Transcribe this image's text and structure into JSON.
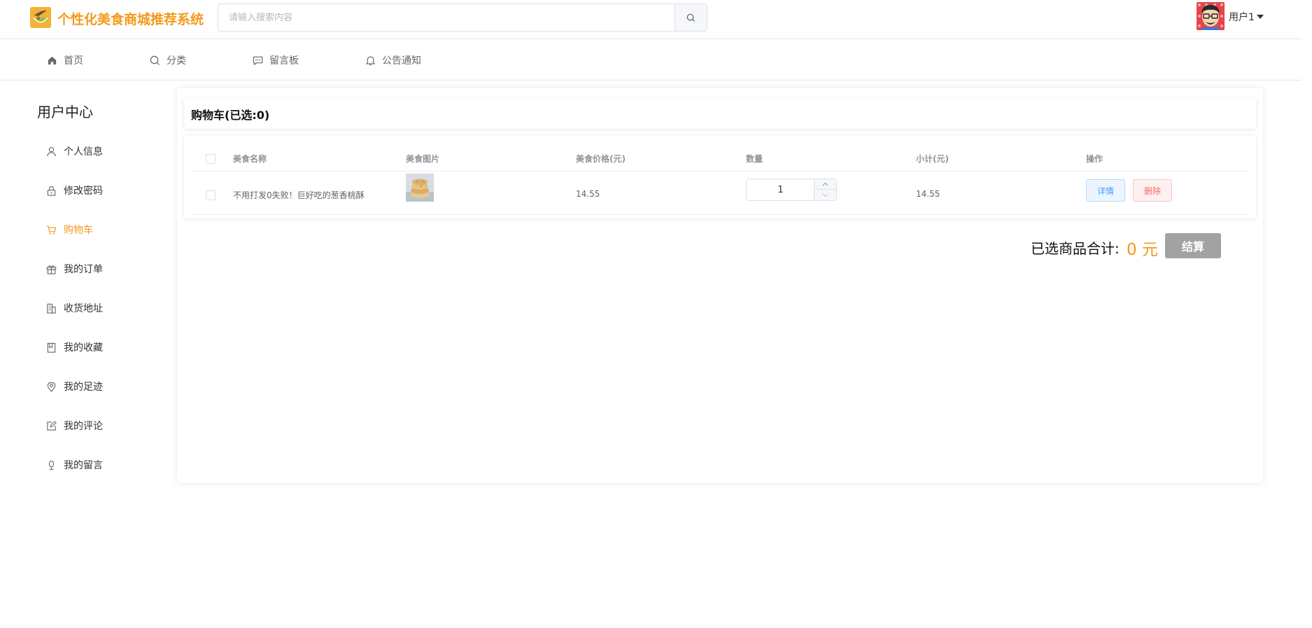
{
  "header": {
    "brand": "个性化美食商城推荐系统",
    "search_placeholder": "请输入搜索内容",
    "user_name": "用户1"
  },
  "nav": [
    {
      "label": "首页",
      "icon": "home-icon"
    },
    {
      "label": "分类",
      "icon": "search-icon"
    },
    {
      "label": "留言板",
      "icon": "message-icon"
    },
    {
      "label": "公告通知",
      "icon": "bell-icon"
    }
  ],
  "sidebar": {
    "title": "用户中心",
    "items": [
      {
        "label": "个人信息",
        "icon": "user-icon"
      },
      {
        "label": "修改密码",
        "icon": "lock-icon"
      },
      {
        "label": "购物车",
        "icon": "cart-icon",
        "active": true
      },
      {
        "label": "我的订单",
        "icon": "gift-icon"
      },
      {
        "label": "收货地址",
        "icon": "building-icon"
      },
      {
        "label": "我的收藏",
        "icon": "bookmark-icon"
      },
      {
        "label": "我的足迹",
        "icon": "location-icon"
      },
      {
        "label": "我的评论",
        "icon": "edit-icon"
      },
      {
        "label": "我的留言",
        "icon": "microphone-icon"
      }
    ]
  },
  "cart": {
    "title": "购物车(已选:0)",
    "columns": [
      "美食名称",
      "美食图片",
      "美食价格(元)",
      "数量",
      "小计(元)",
      "操作"
    ],
    "rows": [
      {
        "name": "不用打发0失败！巨好吃的葱香桃酥",
        "price": "14.55",
        "quantity": "1",
        "subtotal": "14.55",
        "detail_label": "详情",
        "delete_label": "删除"
      }
    ],
    "total_label": "已选商品合计:",
    "total_value": "0 元",
    "checkout_label": "结算"
  },
  "colors": {
    "accent": "#f39a1c",
    "primary": "#409eff",
    "danger": "#f56c6c"
  }
}
